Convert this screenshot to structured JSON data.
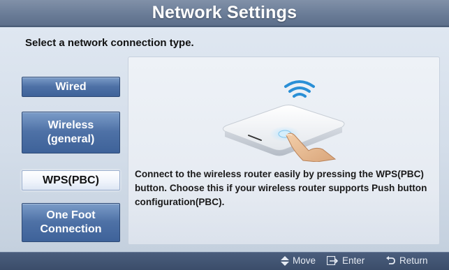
{
  "window": {
    "title": "Network Settings"
  },
  "instruction": "Select a network connection type.",
  "options": [
    {
      "id": "wired",
      "label_line1": "Wired",
      "label_line2": "",
      "selected": false
    },
    {
      "id": "wireless",
      "label_line1": "Wireless",
      "label_line2": "(general)",
      "selected": false
    },
    {
      "id": "wps",
      "label_line1": "WPS(PBC)",
      "label_line2": "",
      "selected": true
    },
    {
      "id": "onefoot",
      "label_line1": "One Foot",
      "label_line2": "Connection",
      "selected": false
    }
  ],
  "detail": {
    "illustration_icon": "router-push-button-icon",
    "description": "Connect to the wireless router easily by pressing the WPS(PBC) button. Choose this if your wireless router supports Push button configuration(PBC)."
  },
  "footer": {
    "hints": [
      {
        "icon": "up-down-arrows-icon",
        "label": "Move"
      },
      {
        "icon": "enter-icon",
        "label": "Enter"
      },
      {
        "icon": "return-icon",
        "label": "Return"
      }
    ]
  },
  "colors": {
    "title_bar": "#6a7c97",
    "button_blue": "#4e71a6",
    "button_selected": "#ffffff",
    "panel_bg": "#e6ebf2",
    "footer_bg": "#3b4d6a",
    "wifi_blue": "#2a8fd6"
  }
}
